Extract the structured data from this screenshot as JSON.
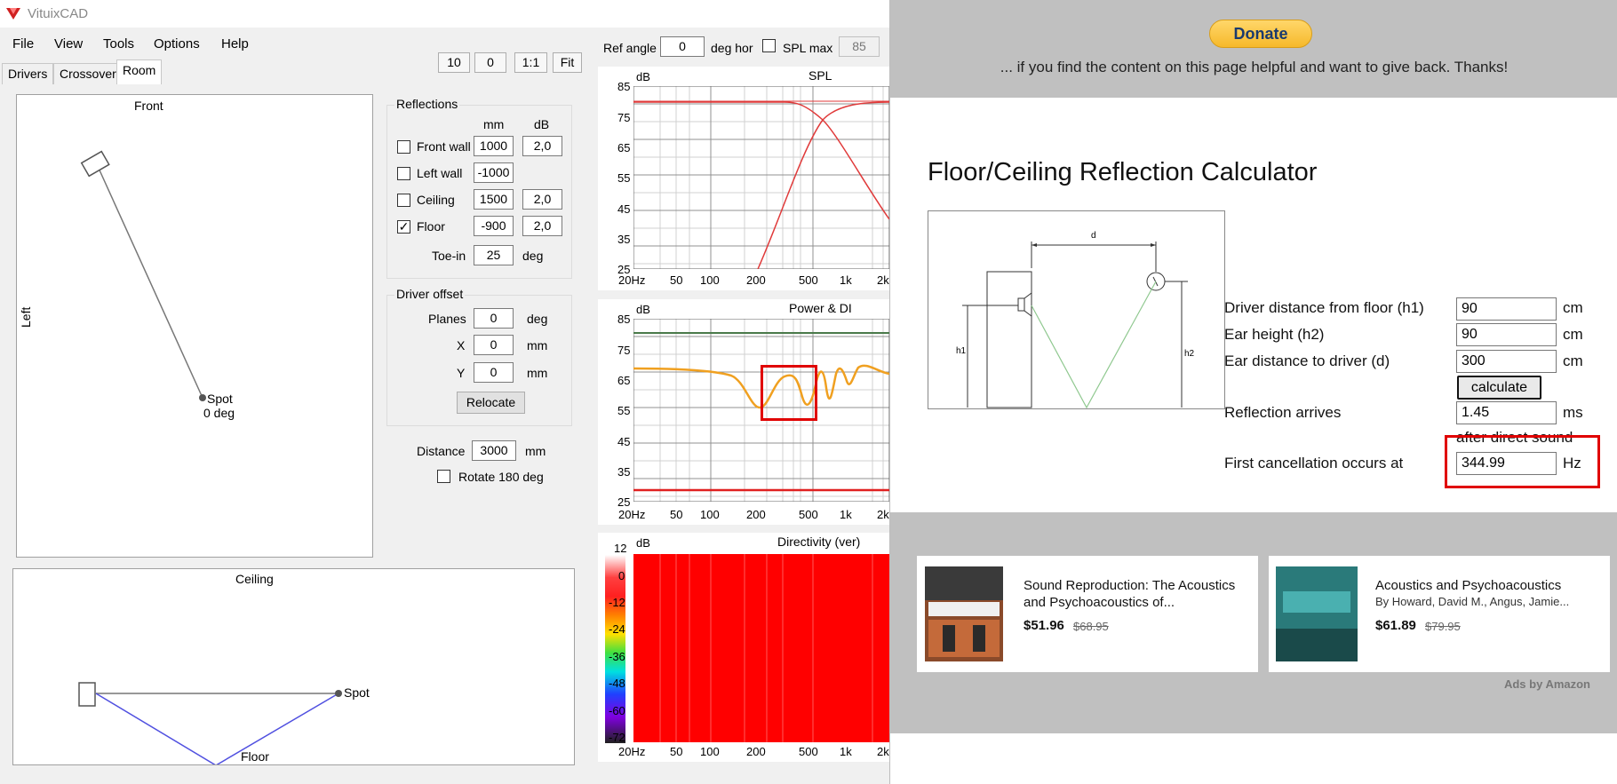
{
  "vcad": {
    "title": "VituixCAD",
    "menu": [
      "File",
      "View",
      "Tools",
      "Options",
      "Help"
    ],
    "tabs": [
      "Drivers",
      "Crossover",
      "Room"
    ],
    "toolbar": {
      "zoom_a": "10",
      "zoom_b": "0",
      "one_to_one": "1:1",
      "fit": "Fit"
    },
    "front_view": {
      "title": "Front",
      "side_label": "Left",
      "spot_label": "Spot",
      "spot_deg": "0 deg"
    },
    "ceiling_view": {
      "title": "Ceiling",
      "spot_label": "Spot",
      "floor_label": "Floor"
    },
    "reflections": {
      "title": "Reflections",
      "col_mm": "mm",
      "col_db": "dB",
      "rows": [
        {
          "label": "Front wall",
          "checked": false,
          "mm": "1000",
          "db": "2,0"
        },
        {
          "label": "Left wall",
          "checked": false,
          "mm": "-1000",
          "db": ""
        },
        {
          "label": "Ceiling",
          "checked": false,
          "mm": "1500",
          "db": "2,0"
        },
        {
          "label": "Floor",
          "checked": true,
          "mm": "-900",
          "db": "2,0"
        }
      ],
      "toe_in_label": "Toe-in",
      "toe_in_value": "25",
      "toe_in_unit": "deg"
    },
    "driver_offset": {
      "title": "Driver offset",
      "planes_label": "Planes",
      "planes_value": "0",
      "planes_unit": "deg",
      "x_label": "X",
      "x_value": "0",
      "x_unit": "mm",
      "y_label": "Y",
      "y_value": "0",
      "y_unit": "mm",
      "relocate": "Relocate"
    },
    "distance_label": "Distance",
    "distance_value": "3000",
    "distance_unit": "mm",
    "rotate_label": "Rotate 180 deg",
    "ref_angle_label": "Ref angle",
    "ref_angle_value": "0",
    "ref_angle_unit": "deg hor",
    "spl_max_label": "SPL max",
    "spl_max_value": "85",
    "graphs": {
      "spl": {
        "title": "SPL",
        "unit": "dB",
        "yticks": [
          "85",
          "75",
          "65",
          "55",
          "45",
          "35",
          "25"
        ]
      },
      "power": {
        "title": "Power & DI",
        "unit": "dB",
        "yticks": [
          "85",
          "75",
          "65",
          "55",
          "45",
          "35",
          "25"
        ]
      },
      "directivity": {
        "title": "Directivity (ver)",
        "unit": "dB",
        "yticks": [
          "12",
          "0",
          "-12",
          "-24",
          "-36",
          "-48",
          "-60",
          "-72"
        ]
      },
      "xticks": [
        "20Hz",
        "50",
        "100",
        "200",
        "500",
        "1k",
        "2k"
      ]
    }
  },
  "web": {
    "donate": "Donate",
    "donate_text": "... if you find the content on this page helpful and want to give back. Thanks!",
    "calc_title": "Floor/Ceiling Reflection Calculator",
    "diagram_labels": {
      "d": "d",
      "h1": "h1",
      "h2": "h2"
    },
    "rows": {
      "h1_label": "Driver distance from floor (h1)",
      "h1_value": "90",
      "h1_unit": "cm",
      "h2_label": "Ear height (h2)",
      "h2_value": "90",
      "h2_unit": "cm",
      "d_label": "Ear distance to driver (d)",
      "d_value": "300",
      "d_unit": "cm",
      "calculate": "calculate",
      "arrives_label": "Reflection arrives",
      "arrives_value": "1.45",
      "arrives_unit": "ms",
      "after_text": "after direct sound",
      "cancel_label": "First cancellation occurs at",
      "cancel_value": "344.99",
      "cancel_unit": "Hz"
    },
    "ads": [
      {
        "title": "Sound Reproduction: The Acoustics and Psychoacoustics of...",
        "byline": "",
        "price": "$51.96",
        "old_price": "$68.95"
      },
      {
        "title": "Acoustics and Psychoacoustics",
        "byline": "By Howard, David M., Angus, Jamie...",
        "price": "$61.89",
        "old_price": "$79.95"
      }
    ],
    "ads_by": "Ads by Amazon"
  },
  "colors": {
    "accent_red": "#e00000",
    "graph_red": "#e03a3a",
    "orange": "#f0a020",
    "floor_blue": "#5050e0"
  }
}
